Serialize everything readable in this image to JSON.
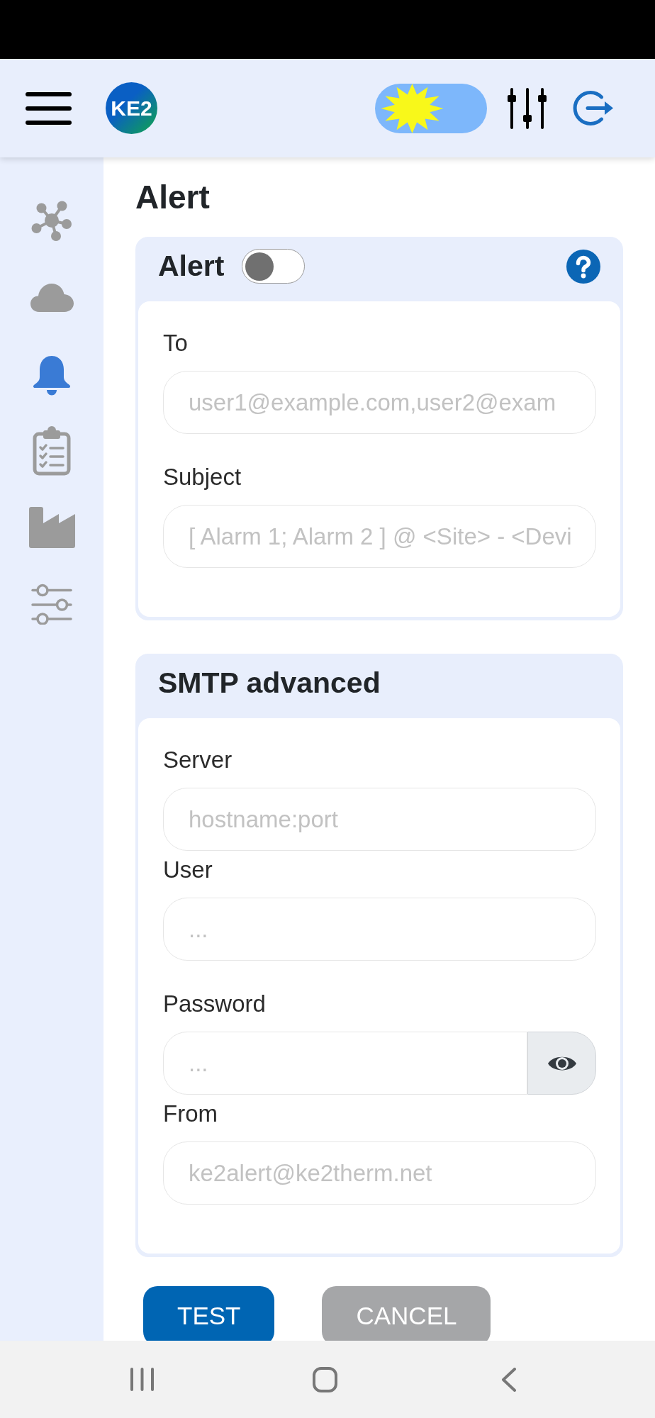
{
  "header": {
    "logo_text": "KE2",
    "dark_mode": false
  },
  "sidebar": {
    "items": [
      {
        "selected": false
      },
      {
        "selected": false
      },
      {
        "selected": true
      },
      {
        "selected": false
      },
      {
        "selected": false
      },
      {
        "selected": false
      }
    ]
  },
  "page_title": "Alert",
  "cards": [
    {
      "title": "Alert",
      "enabled": false,
      "help": true,
      "fields": [
        {
          "label": "To",
          "kind": "text",
          "placeholder": "user1@example.com,user2@exam"
        },
        {
          "label": "Subject",
          "kind": "text",
          "placeholder": "[ Alarm 1; Alarm 2 ] @ <Site> - <Devi"
        }
      ]
    },
    {
      "title": "SMTP advanced",
      "fields": [
        {
          "label": "Server",
          "kind": "text",
          "placeholder": "hostname:port"
        },
        {
          "label": "User",
          "kind": "text",
          "placeholder": "..."
        },
        {
          "label": "Password",
          "kind": "password",
          "placeholder": "..."
        },
        {
          "label": "From",
          "kind": "text",
          "placeholder": "ke2alert@ke2therm.net"
        }
      ]
    }
  ],
  "buttons": [
    {
      "label": "TEST",
      "kind": "primary"
    },
    {
      "label": "CANCEL",
      "kind": "secondary"
    }
  ]
}
